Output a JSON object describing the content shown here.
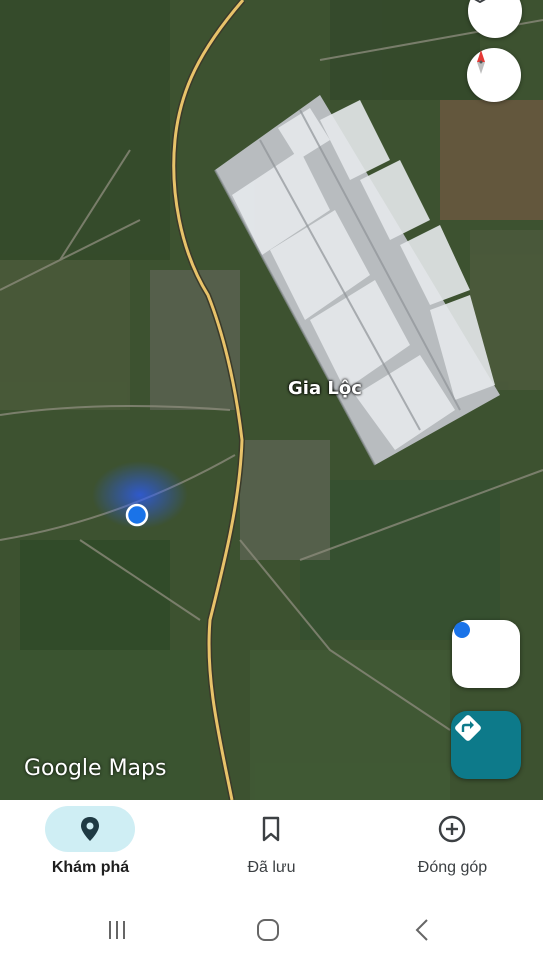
{
  "map": {
    "place_label": "Gia Lộc",
    "attribution": "Google Maps",
    "road_color": "#e8c36a",
    "accent_blue": "#1a73e8"
  },
  "controls": {
    "layers": "layers-icon",
    "compass": "compass-icon",
    "my_location": "my-location-icon",
    "directions": "directions-icon"
  },
  "bottom_nav": {
    "items": [
      {
        "label": "Khám phá",
        "icon": "explore-pin-icon",
        "active": true
      },
      {
        "label": "Đã lưu",
        "icon": "bookmark-icon",
        "active": false
      },
      {
        "label": "Đóng góp",
        "icon": "add-circle-icon",
        "active": false
      }
    ]
  },
  "system_bar": {
    "buttons": [
      "recent-apps-icon",
      "home-icon",
      "back-icon"
    ]
  }
}
